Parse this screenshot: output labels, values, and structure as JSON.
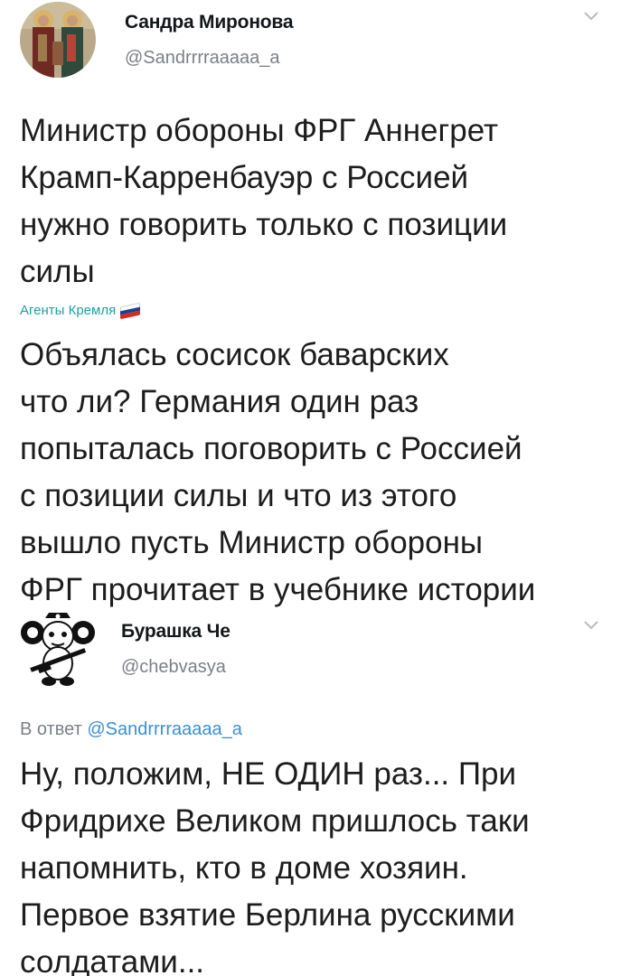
{
  "tweet1": {
    "author_name": "Сандра Миронова",
    "author_handle": "@Sandrrrraaaaa_a",
    "avatar_icon": "religious-icon-avatar",
    "text": "Министр обороны ФРГ Аннегрет\nКрамп-Карренбауэр с Россией\nнужно говорить только  с позиции\nсилы"
  },
  "source": {
    "label": "Агенты Кремля",
    "flag_icon": "russian-flag-icon",
    "flag_colors": [
      "#ffffff",
      "#1c3f94",
      "#d52b1e"
    ]
  },
  "comment": {
    "text": "Объялась сосисок баварских\nчто ли? Германия один раз\nпопыталась поговорить с Россией\nс позиции силы и что из этого\nвышло пусть Министр обороны\nФРГ прочитает в учебнике истории"
  },
  "tweet2": {
    "author_name": "Бурашка Че",
    "author_handle": "@chebvasya",
    "avatar_icon": "cheburashka-icon-avatar",
    "reply_prefix": "В ответ",
    "reply_mention": "@Sandrrrraaaaa_a",
    "text": "Ну, положим, НЕ ОДИН раз... При\nФридрихе Великом пришлось таки\nнапомнить, кто в доме хозяин.\nПервое взятие Берлина русскими\nсолдатами..."
  },
  "colors": {
    "accent_link": "#3b8fd4",
    "source_teal": "#1f9ea6",
    "muted_gray": "#7b8087"
  }
}
